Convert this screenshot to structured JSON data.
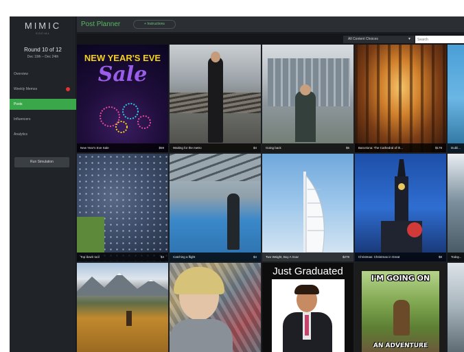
{
  "sidebar": {
    "logo": "MIMIC",
    "logo_sub": "SOCIAL",
    "round_title": "Round 10 of 12",
    "round_dates": "Dec 19th – Dec 24th",
    "nav": [
      {
        "label": "Overview"
      },
      {
        "label": "Weekly Memos"
      },
      {
        "label": "Posts"
      },
      {
        "label": "Influencers"
      },
      {
        "label": "Analytics"
      }
    ],
    "run_button": "Run Simulation"
  },
  "header": {
    "title": "Post Planner",
    "action_label": "+ Instructions"
  },
  "filter": {
    "select_value": "All Content Choices",
    "search_placeholder": "Search"
  },
  "tiles": [
    {
      "caption": "New Year's Eve Sale",
      "amount": "$59",
      "overlay_line1": "NEW YEAR'S EVE",
      "overlay_line2": "Sale"
    },
    {
      "caption": "Waiting for the metro",
      "amount": "$4"
    },
    {
      "caption": "Going back",
      "amount": "$6"
    },
    {
      "caption": "Barcelona: The Cathedral of th...",
      "amount": "$178"
    },
    {
      "caption": "Dubli...",
      "amount": ""
    },
    {
      "caption": "Top down tool",
      "amount": "$4"
    },
    {
      "caption": "Catching a flight",
      "amount": "$4"
    },
    {
      "caption": "Two Weight, Buy A Scar",
      "amount": "$278"
    },
    {
      "caption": "Christmas: Christmas in Great",
      "amount": "$8"
    },
    {
      "caption": "Today...",
      "amount": ""
    },
    {
      "caption": "",
      "amount": ""
    },
    {
      "caption": "",
      "amount": ""
    },
    {
      "caption": "",
      "amount": "",
      "overlay_line1": "Just Graduated"
    },
    {
      "caption": "",
      "amount": "",
      "overlay_line1": "I'M GOING ON",
      "overlay_line2": "AN ADVENTURE"
    },
    {
      "caption": "",
      "amount": ""
    }
  ],
  "colors": {
    "accent_green": "#3aa84a",
    "sidebar_bg": "#202428",
    "notification_red": "#e23232"
  }
}
